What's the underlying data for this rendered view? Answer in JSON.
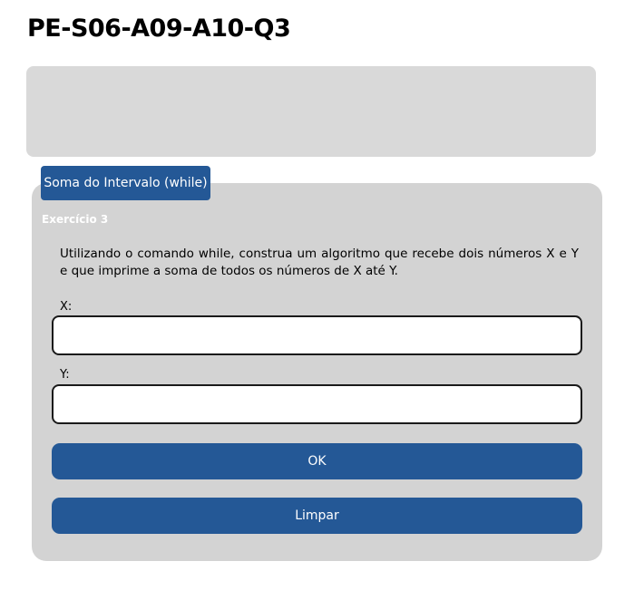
{
  "page": {
    "title": "PE-S06-A09-A10-Q3"
  },
  "exercise": {
    "tab_label": "Soma do Intervalo (while)",
    "label": "Exercício 3",
    "description": "Utilizando o comando while, construa um algoritmo que recebe dois números X e Y e que imprime a soma de todos os números de X até Y.",
    "fields": {
      "x": {
        "label": "X:",
        "value": ""
      },
      "y": {
        "label": "Y:",
        "value": ""
      }
    },
    "buttons": {
      "ok_label": "OK",
      "clear_label": "Limpar"
    }
  },
  "colors": {
    "primary_button": "#245896",
    "card_background": "#d3d3d3",
    "top_panel_background": "#d9d9d9"
  }
}
